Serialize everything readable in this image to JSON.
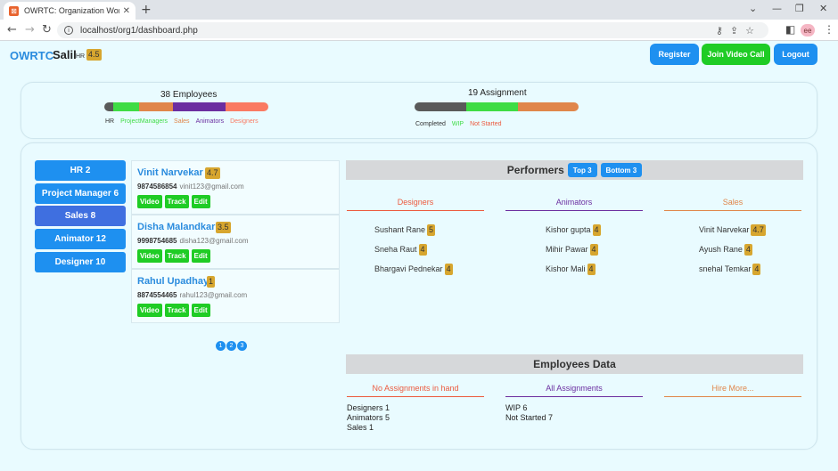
{
  "browser": {
    "tab_title": "OWRTC: Organization Workflow",
    "favicon_glyph": "⊠",
    "close_glyph": "✕",
    "new_tab_glyph": "+",
    "url": "localhost/org1/dashboard.php",
    "profile_initials": "ee",
    "window_controls": [
      "⌄",
      "—",
      "❐",
      "✕"
    ]
  },
  "header": {
    "brand": "OWRTC",
    "user_name": "Salil",
    "user_role": "HR",
    "user_rating": "4.5",
    "buttons": {
      "register": "Register",
      "join_video": "Join Video Call",
      "logout": "Logout"
    }
  },
  "summary": {
    "employees": {
      "title": "38 Employees",
      "segments": [
        {
          "label": "HR",
          "count": 2,
          "color": "#5a5a5a"
        },
        {
          "label": "ProjectManagers",
          "count": 6,
          "color": "#3fdc44"
        },
        {
          "label": "Sales",
          "count": 8,
          "color": "#e0864a"
        },
        {
          "label": "Animators",
          "count": 12,
          "color": "#6b2ea0"
        },
        {
          "label": "Designers",
          "count": 10,
          "color": "#fa7a62"
        }
      ]
    },
    "assignments": {
      "title": "19 Assignment",
      "segments": [
        {
          "label": "Completed",
          "count": 6,
          "color": "#5a5a5a"
        },
        {
          "label": "WIP",
          "count": 6,
          "color": "#3fdc44"
        },
        {
          "label": "Not Started",
          "count": 7,
          "color": "#e0864a"
        }
      ]
    }
  },
  "sidebar": {
    "items": [
      {
        "label": "HR 2",
        "active": false
      },
      {
        "label": "Project Manager 6",
        "active": false
      },
      {
        "label": "Sales 8",
        "active": true
      },
      {
        "label": "Animator 12",
        "active": false
      },
      {
        "label": "Designer 10",
        "active": false
      }
    ]
  },
  "employees": [
    {
      "name": "Vinit Narvekar",
      "rating": "4.7",
      "phone": "9874586854",
      "email": "vinit123@gmail.com"
    },
    {
      "name": "Disha Malandkar",
      "rating": "3.5",
      "phone": "9998754685",
      "email": "disha123@gmail.com"
    },
    {
      "name": "Rahul Upadhay",
      "rating": "1",
      "phone": "8874554465",
      "email": "rahul123@gmail.com"
    }
  ],
  "employee_actions": {
    "video": "Video",
    "track": "Track",
    "edit": "Edit"
  },
  "pager": [
    "1",
    "2",
    "3"
  ],
  "performers": {
    "title": "Performers",
    "top_button": "Top 3",
    "bottom_button": "Bottom 3",
    "columns": [
      {
        "title": "Designers",
        "color": "#ec5a3e",
        "people": [
          {
            "name": "Sushant Rane",
            "rating": "5"
          },
          {
            "name": "Sneha Raut",
            "rating": "4"
          },
          {
            "name": "Bhargavi Pednekar",
            "rating": "4"
          }
        ]
      },
      {
        "title": "Animators",
        "color": "#6b2ea0",
        "people": [
          {
            "name": "Kishor gupta",
            "rating": "4"
          },
          {
            "name": "Mihir Pawar",
            "rating": "4"
          },
          {
            "name": "Kishor Mali",
            "rating": "4"
          }
        ]
      },
      {
        "title": "Sales",
        "color": "#e0864a",
        "people": [
          {
            "name": "Vinit Narvekar",
            "rating": "4.7"
          },
          {
            "name": "Ayush Rane",
            "rating": "4"
          },
          {
            "name": "snehal Temkar",
            "rating": "4"
          }
        ]
      }
    ]
  },
  "employees_data": {
    "title": "Employees Data",
    "columns": [
      {
        "title": "No Assignments in hand",
        "color": "#ec5a3e",
        "lines": [
          "Designers 1",
          "Animators 5",
          "Sales 1"
        ]
      },
      {
        "title": "All Assignments",
        "color": "#6b2ea0",
        "lines": [
          "WIP 6",
          "Not Started 7"
        ]
      },
      {
        "title": "Hire More...",
        "color": "#e0864a",
        "lines": []
      }
    ]
  }
}
